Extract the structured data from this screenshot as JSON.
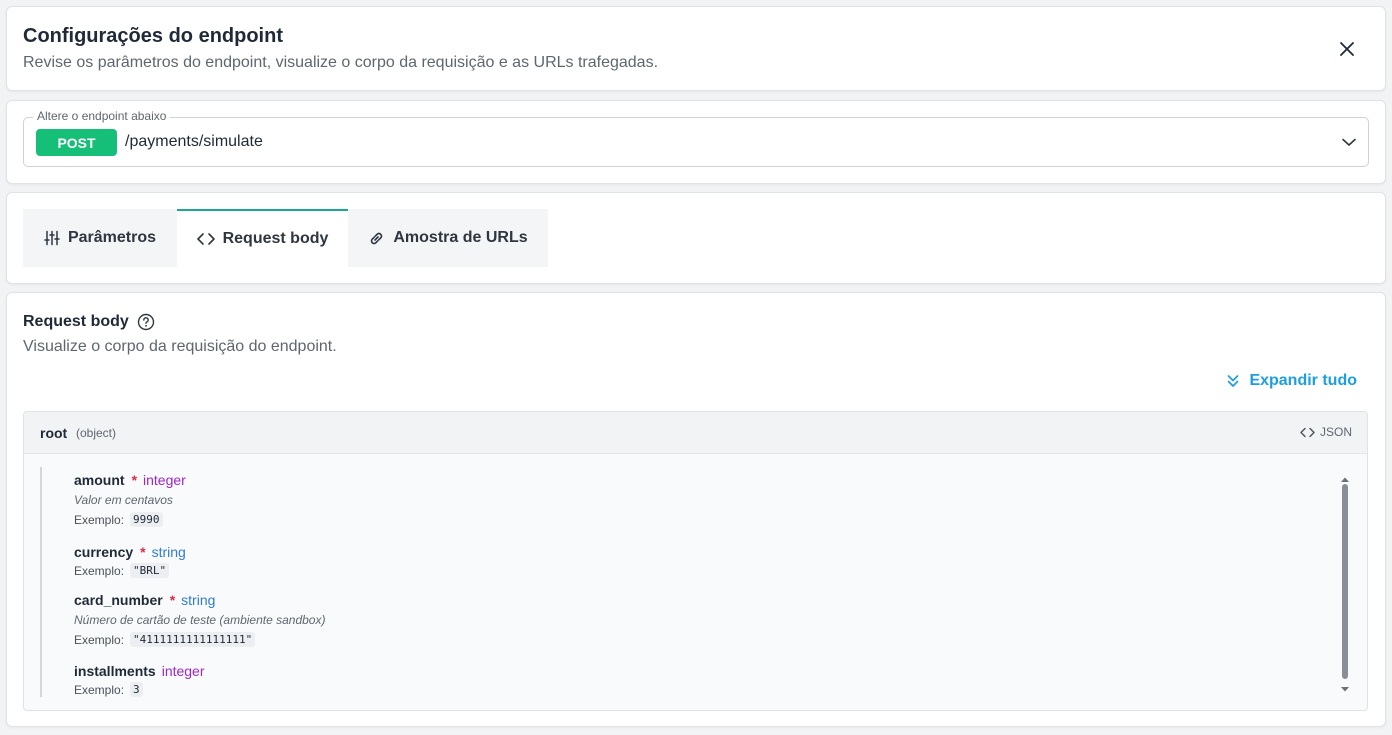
{
  "header": {
    "title": "Configurações do endpoint",
    "subtitle": "Revise os parâmetros do endpoint, visualize o corpo da requisição e as URLs trafegadas."
  },
  "endpoint": {
    "legend": "Altere o endpoint abaixo",
    "method": "POST",
    "path": "/payments/simulate",
    "method_color": "#16bf78"
  },
  "tabs": [
    {
      "label": "Parâmetros",
      "icon": "sliders-icon",
      "active": false
    },
    {
      "label": "Request body",
      "icon": "code-icon",
      "active": true
    },
    {
      "label": "Amostra de URLs",
      "icon": "link-icon",
      "active": false
    }
  ],
  "request_body": {
    "title": "Request body",
    "subtitle": "Visualize o corpo da requisição do endpoint.",
    "expand_label": "Expandir tudo",
    "root": {
      "name": "root",
      "type": "(object)",
      "json_label": "JSON"
    },
    "example_label": "Exemplo:",
    "properties": [
      {
        "name": "amount",
        "required": "*",
        "type": "integer",
        "description": "Valor em centavos",
        "example": "9990"
      },
      {
        "name": "currency",
        "required": "*",
        "type": "string",
        "description": "",
        "example": "\"BRL\""
      },
      {
        "name": "card_number",
        "required": "*",
        "type": "string",
        "description": "Número de cartão de teste (ambiente sandbox)",
        "example": "\"4111111111111111\""
      },
      {
        "name": "installments",
        "required": "",
        "type": "integer",
        "description": "",
        "example": "3"
      }
    ]
  },
  "colors": {
    "accent_tab": "#1fa49a",
    "link": "#1b9fe0",
    "required": "#e0294a",
    "type_integer": "#9b28c8",
    "type_string": "#2f7bd6"
  }
}
